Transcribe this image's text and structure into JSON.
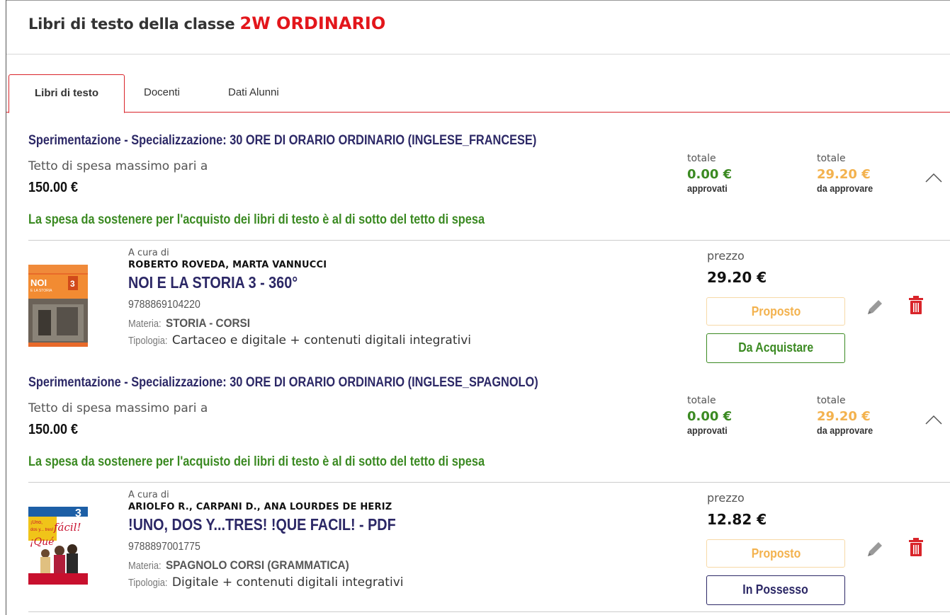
{
  "header": {
    "title_prefix": "Libri di testo della classe",
    "class_name": "2W ORDINARIO"
  },
  "tabs": [
    {
      "label": "Libri di testo",
      "active": true
    },
    {
      "label": "Docenti",
      "active": false
    },
    {
      "label": "Dati Alunni",
      "active": false
    }
  ],
  "colors": {
    "accent_red": "#e3161b",
    "title_navy": "#2c2866",
    "ok_green": "#3b8a22",
    "pending_orange": "#f3b24e"
  },
  "sections": [
    {
      "title": "Sperimentazione - Specializzazione: 30 ORE DI ORARIO ORDINARIO (INGLESE_FRANCESE)",
      "tetto_label": "Tetto di spesa massimo pari a",
      "tetto_value": "150.00 €",
      "message": "La spesa da sostenere per l'acquisto dei libri di testo è al di sotto del tetto di spesa",
      "approved": {
        "label": "totale",
        "value": "0.00 €",
        "sub": "approvati"
      },
      "pending": {
        "label": "totale",
        "value": "29.20 €",
        "sub": "da approvare"
      },
      "chevron_icon": "chevron-up-icon",
      "book": {
        "curated_label": "A cura di",
        "authors": "ROBERTO ROVEDA, MARTA VANNUCCI",
        "title": "NOI E LA STORIA 3 - 360°",
        "isbn": "9788869104220",
        "materia_label": "Materia:",
        "materia": "STORIA - CORSI",
        "tipologia_label": "Tipologia:",
        "tipologia": "Cartaceo e digitale + contenuti digitali integrativi",
        "price_label": "prezzo",
        "price": "29.20 €",
        "status_button": "Proposto",
        "action_button": "Da Acquistare",
        "cover_text": {
          "line1": "NOI",
          "line2": "E LA STORIA",
          "volume": "3"
        }
      }
    },
    {
      "title": "Sperimentazione - Specializzazione: 30 ORE DI ORARIO ORDINARIO (INGLESE_SPAGNOLO)",
      "tetto_label": "Tetto di spesa massimo pari a",
      "tetto_value": "150.00 €",
      "message": "La spesa da sostenere per l'acquisto dei libri di testo è al di sotto del tetto di spesa",
      "approved": {
        "label": "totale",
        "value": "0.00 €",
        "sub": "approvati"
      },
      "pending": {
        "label": "totale",
        "value": "29.20 €",
        "sub": "da approvare"
      },
      "chevron_icon": "chevron-up-icon",
      "book": {
        "curated_label": "A cura di",
        "authors": "ARIOLFO R., CARPANI D., ANA LOURDES DE HERIZ",
        "title": "!UNO, DOS Y...TRES! !QUE FACIL! - PDF",
        "isbn": "9788897001775",
        "materia_label": "Materia:",
        "materia": "SPAGNOLO CORSI (GRAMMATICA)",
        "tipologia_label": "Tipologia:",
        "tipologia": "Digitale + contenuti digitali integrativi",
        "price_label": "prezzo",
        "price": "12.82 €",
        "status_button": "Proposto",
        "action_button": "In Possesso",
        "cover_text": {
          "line1": "¡Uno,",
          "line2": "dos y... tres!",
          "script": "fácil!",
          "script2": "¡Qué",
          "volume": "3"
        }
      }
    }
  ]
}
